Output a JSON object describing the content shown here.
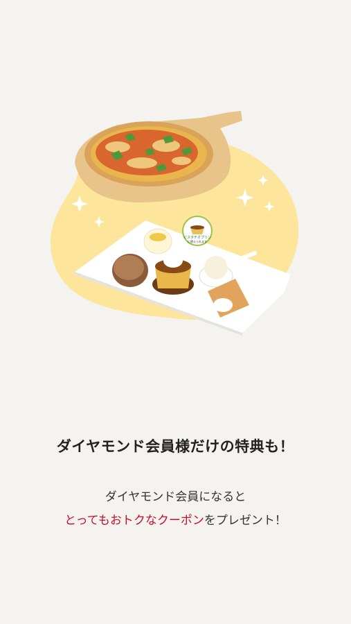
{
  "hero": {
    "badge_line1": "ピスタチオプリン",
    "badge_line2": "に替えられます",
    "colors": {
      "blob": "#fde69b",
      "board": "#e8c48a"
    }
  },
  "headline": "ダイヤモンド会員様だけの特典も！",
  "description": {
    "line1": "ダイヤモンド会員になると",
    "line2_highlight": "とってもおトクなクーポン",
    "line2_rest": "をプレゼント！",
    "highlight_color": "#c8102e"
  }
}
